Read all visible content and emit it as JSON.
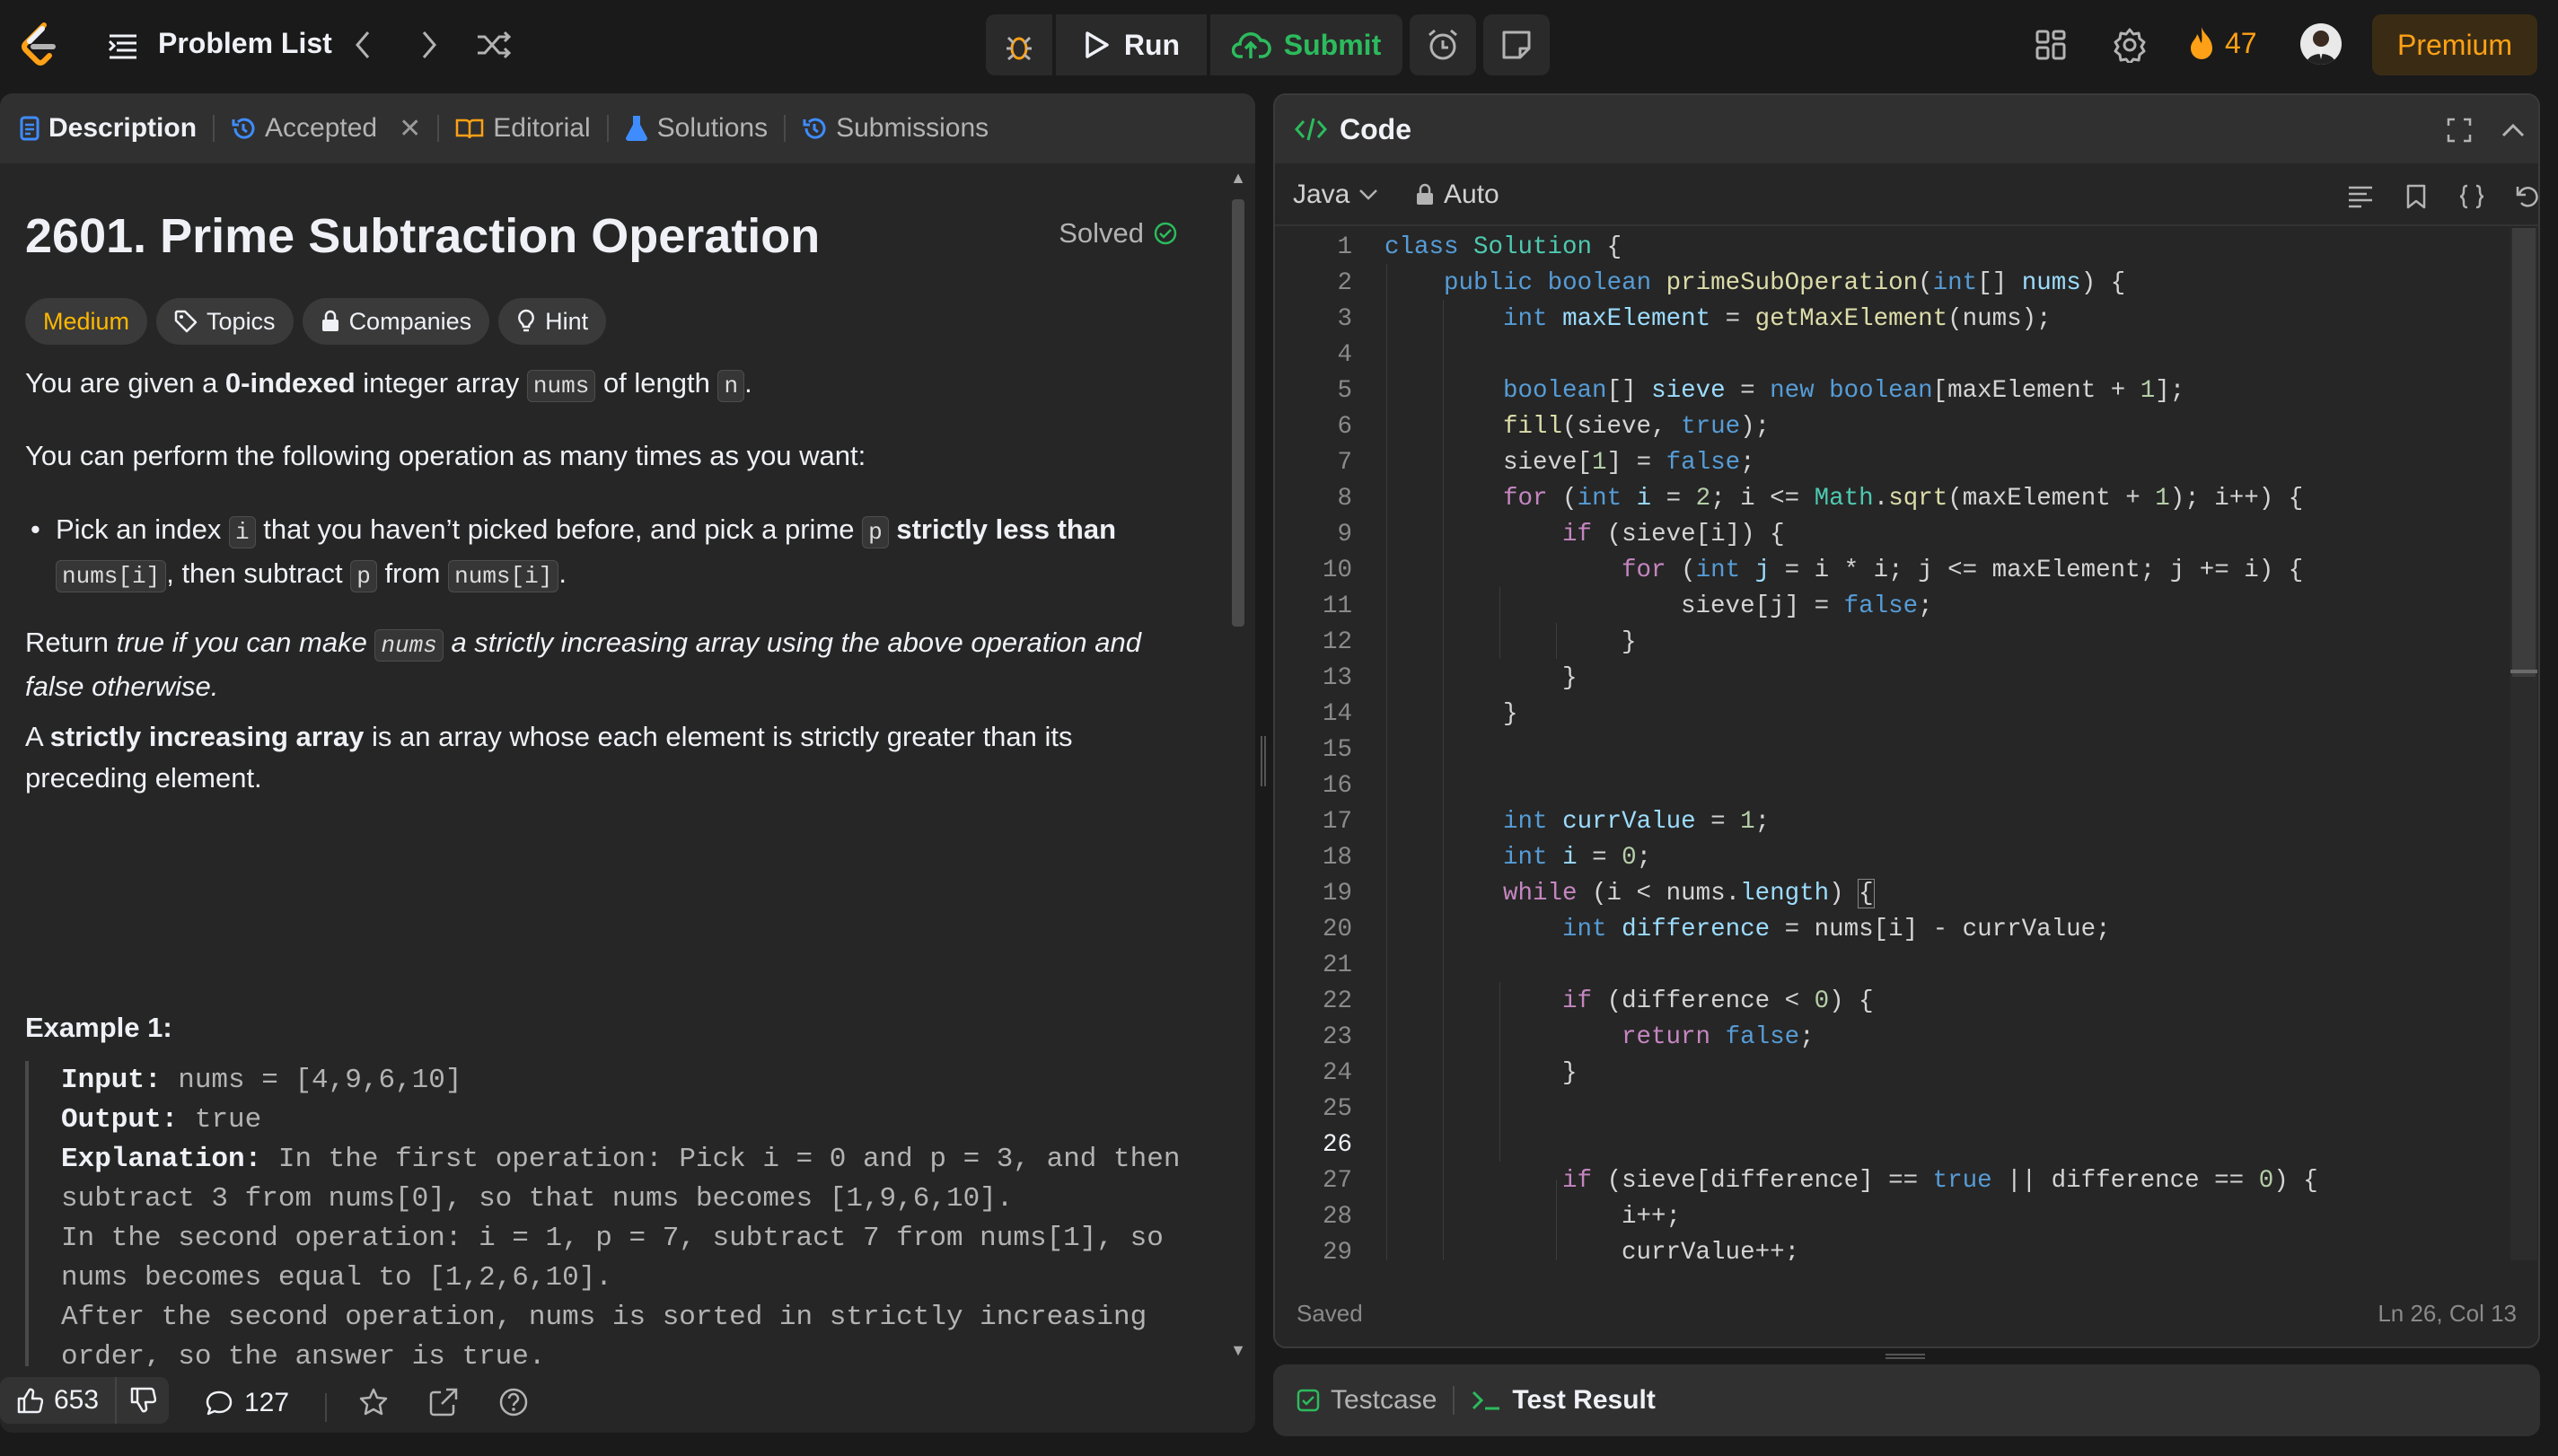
{
  "nav": {
    "problem_list": "Problem List",
    "run": "Run",
    "submit": "Submit",
    "streak": "47",
    "premium": "Premium"
  },
  "tabs": {
    "description": "Description",
    "accepted": "Accepted",
    "editorial": "Editorial",
    "solutions": "Solutions",
    "submissions": "Submissions"
  },
  "problem": {
    "title": "2601. Prime Subtraction Operation",
    "status": "Solved",
    "difficulty": "Medium",
    "chips": [
      "Topics",
      "Companies",
      "Hint"
    ],
    "example_title": "Example 1:",
    "example": {
      "input_label": "Input:",
      "input": " nums = [4,9,6,10]",
      "output_label": "Output:",
      "output": " true",
      "explanation_label": "Explanation:",
      "explanation": " In the first operation: Pick i = 0 and p = 3, and then subtract 3 from nums[0], so that nums becomes [1,9,6,10].\nIn the second operation: i = 1, p = 7, subtract 7 from nums[1], so nums becomes equal to [1,2,6,10].\nAfter the second operation, nums is sorted in strictly increasing order, so the answer is true."
    }
  },
  "footer": {
    "likes": "653",
    "comments": "127"
  },
  "code": {
    "header": "Code",
    "language": "Java",
    "mode": "Auto",
    "status": "Saved",
    "cursor": "Ln 26, Col 13",
    "current_line": 26
  },
  "test": {
    "testcase": "Testcase",
    "result": "Test Result"
  },
  "colors": {
    "accent": "#ffa116",
    "success": "#2cbb5d",
    "medium": "#ffb800"
  }
}
